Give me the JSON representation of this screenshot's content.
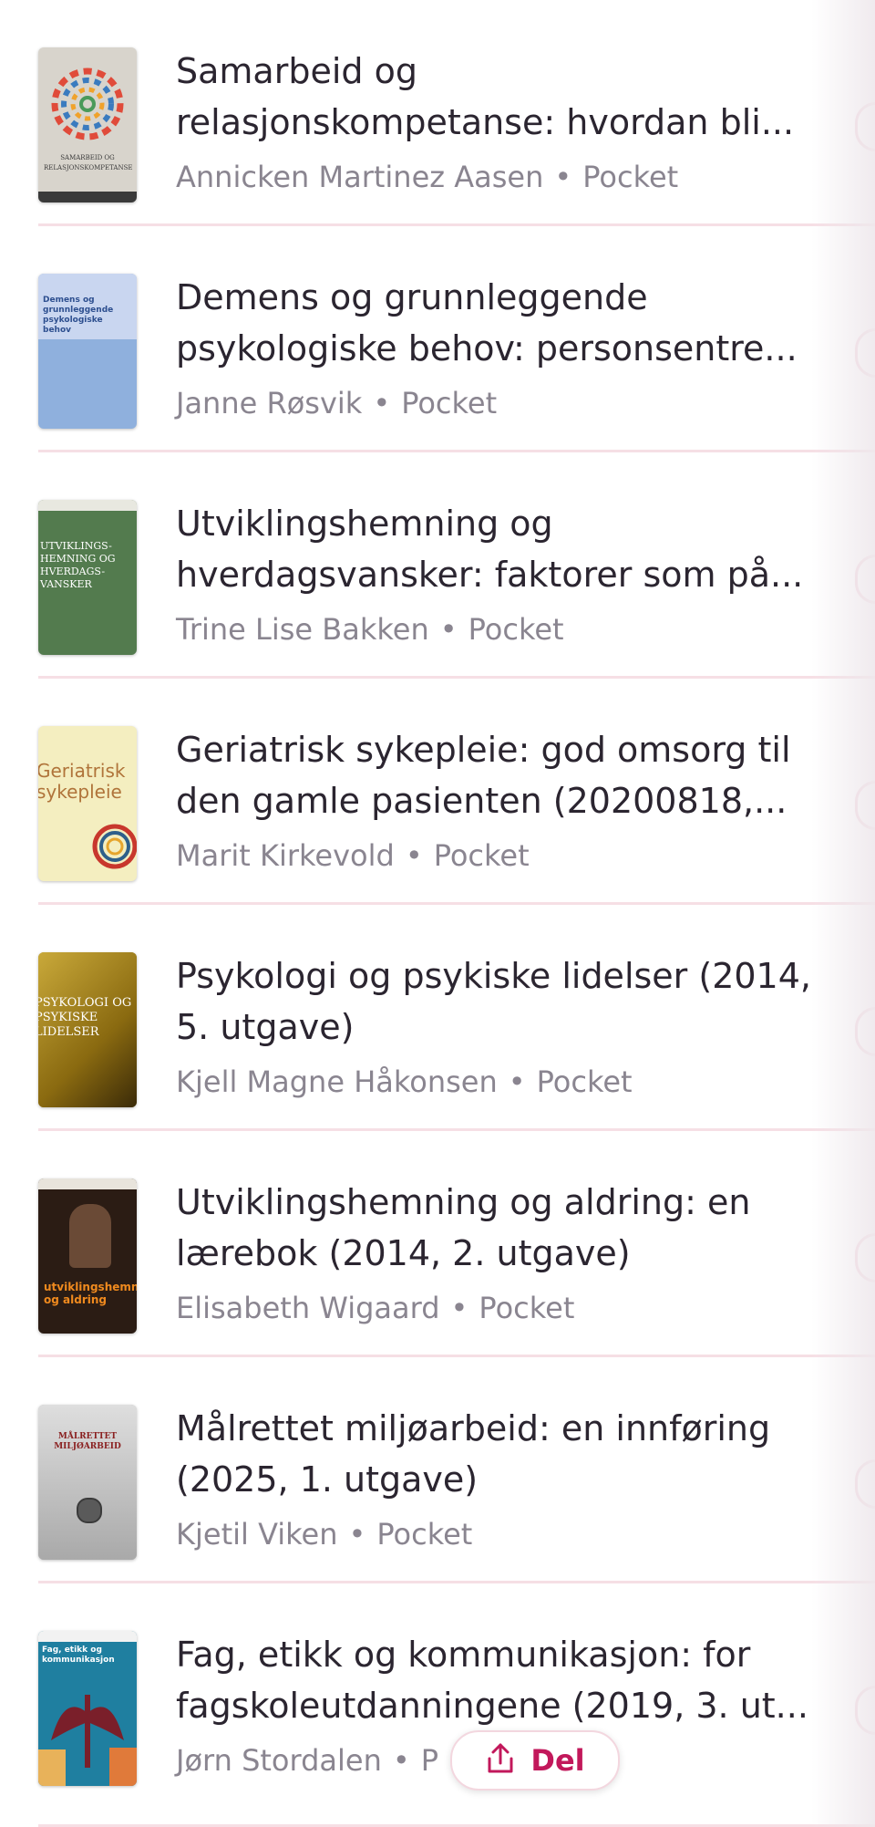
{
  "books": [
    {
      "title_line1": "Samarbeid og",
      "title_line2": "relasjonskompetanse: hvordan bli...",
      "author": "Annicken Martinez Aasen",
      "format": "Pocket",
      "cover_text": "SAMARBEID OG RELASJONSKOMPETANSE"
    },
    {
      "title_line1": "Demens og grunnleggende",
      "title_line2": "psykologiske behov: personsentre...",
      "author": "Janne Røsvik",
      "format": "Pocket",
      "cover_text": "Demens og grunnleggende psykologiske behov"
    },
    {
      "title_line1": "Utviklingshemning og",
      "title_line2": "hverdagsvansker: faktorer som på...",
      "author": "Trine Lise Bakken",
      "format": "Pocket",
      "cover_text": "UTVIKLINGS-HEMNING OG HVERDAGS-VANSKER"
    },
    {
      "title_line1": "Geriatrisk sykepleie: god omsorg til",
      "title_line2": "den gamle pasienten (20200818,...",
      "author": "Marit Kirkevold",
      "format": "Pocket",
      "cover_text": "Geriatrisk sykepleie"
    },
    {
      "title_line1": "Psykologi og psykiske lidelser (2014,",
      "title_line2": "5. utgave)",
      "author": "Kjell Magne Håkonsen",
      "format": "Pocket",
      "cover_text": "PSYKOLOGI OG PSYKISKE LIDELSER"
    },
    {
      "title_line1": "Utviklingshemning og aldring: en",
      "title_line2": "lærebok (2014, 2. utgave)",
      "author": "Elisabeth Wigaard",
      "format": "Pocket",
      "cover_text": "utviklingshemning og aldring"
    },
    {
      "title_line1": "Målrettet miljøarbeid: en innføring",
      "title_line2": "(2025, 1. utgave)",
      "author": "Kjetil Viken",
      "format": "Pocket",
      "cover_text": "MÅLRETTET MILJØARBEID"
    },
    {
      "title_line1": "Fag, etikk og kommunikasjon: for",
      "title_line2": "fagskoleutdanningene (2019, 3. ut...",
      "author": "Jørn Stordalen",
      "format": "P",
      "cover_text": "Fag, etikk og kommunikasjon"
    }
  ],
  "separator": "•",
  "share_button": {
    "label": "Del"
  },
  "colors": {
    "accent": "#c2185b",
    "divider": "#f6dfe5",
    "title": "#2b2530",
    "meta": "#8a8590"
  }
}
